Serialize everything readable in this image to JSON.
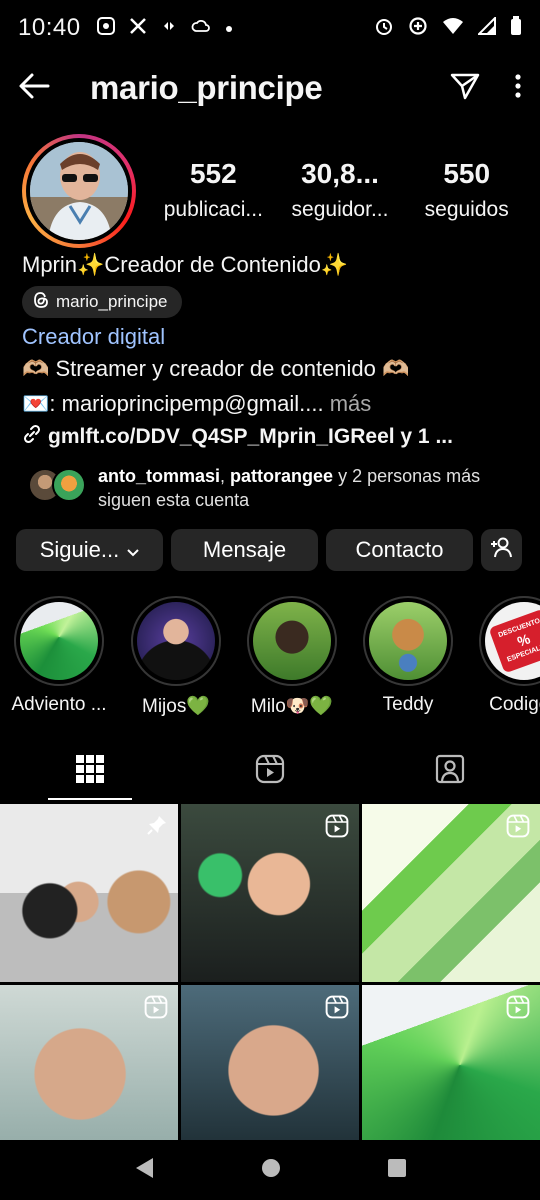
{
  "status_bar": {
    "time": "10:40",
    "left_icons": [
      "music-app-icon",
      "x-app-icon",
      "data-icon",
      "cloud-icon",
      "dot-icon"
    ],
    "right_icons": [
      "alarm-icon",
      "data-saver-icon",
      "wifi-icon",
      "signal-icon",
      "battery-icon"
    ]
  },
  "header": {
    "username": "mario_principe"
  },
  "profile": {
    "stats": [
      {
        "value": "552",
        "label": "publicaci..."
      },
      {
        "value": "30,8...",
        "label": "seguidor..."
      },
      {
        "value": "550",
        "label": "seguidos"
      }
    ],
    "bio_name": "Mprin✨Creador de Contenido✨",
    "threads_handle": "mario_principe",
    "category": "Creador digital",
    "bio_line1": "🫶🏼 Streamer y creador de contenido 🫶🏼",
    "bio_line2": "💌: marioprincipemp@gmail....",
    "bio_more": "más",
    "link": "gmlft.co/DDV_Q4SP_Mprin_IGReel y 1 ..."
  },
  "followers": {
    "name1": "anto_tommasi",
    "separator": ", ",
    "name2": "pattorangee",
    "rest_line1": " y 2 personas más",
    "line2": "siguen esta cuenta"
  },
  "actions": {
    "follow_label": "Siguie...",
    "message_label": "Mensaje",
    "contact_label": "Contacto"
  },
  "highlights": [
    {
      "label": "Adviento ..."
    },
    {
      "label": "Mijos💚"
    },
    {
      "label": "Milo🐶💚"
    },
    {
      "label": "Teddy"
    },
    {
      "label": "Codigos"
    }
  ],
  "highlight_badge": {
    "line1": "DESCUENTO",
    "line2": "%",
    "line3": "ESPECIALES"
  },
  "colors": {
    "link_blue": "#a0c4ff",
    "button_bg": "#262626",
    "story_ring": "#e1306c"
  }
}
